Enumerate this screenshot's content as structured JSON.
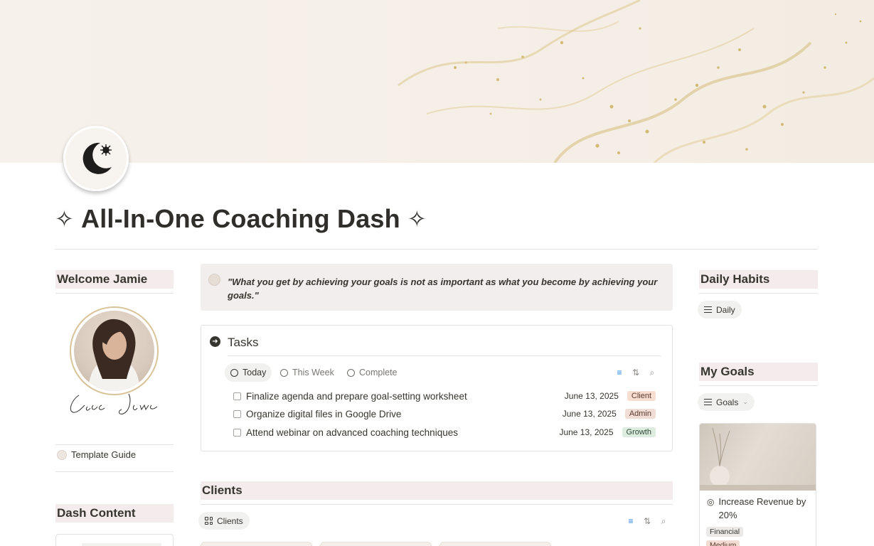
{
  "page": {
    "title": "All-In-One Coaching Dash",
    "title_decoration": "✧"
  },
  "left": {
    "welcome_heading": "Welcome Jamie",
    "template_guide_label": "Template Guide",
    "dash_content_heading": "Dash Content"
  },
  "quote": {
    "text": "\"What you get by achieving your goals is not as important as what you become by achieving your goals.\""
  },
  "tasks": {
    "heading": "Tasks",
    "tabs": [
      {
        "label": "Today",
        "active": true
      },
      {
        "label": "This Week",
        "active": false
      },
      {
        "label": "Complete",
        "active": false
      }
    ],
    "rows": [
      {
        "title": "Finalize agenda and prepare goal-setting worksheet",
        "date": "June 13, 2025",
        "tag": "Client"
      },
      {
        "title": "Organize digital files in Google Drive",
        "date": "June 13, 2025",
        "tag": "Admin"
      },
      {
        "title": "Attend webinar on advanced coaching techniques",
        "date": "June 13, 2025",
        "tag": "Growth"
      }
    ]
  },
  "clients": {
    "heading": "Clients",
    "view_label": "Clients"
  },
  "right": {
    "habits_heading": "Daily Habits",
    "habits_view_label": "Daily",
    "goals_heading": "My Goals",
    "goals_view_label": "Goals",
    "goal_card": {
      "title": "Increase Revenue by 20%",
      "tags": [
        "Financial",
        "Medium"
      ]
    }
  },
  "icons": {
    "page_icon": "crescent-moon-star-icon",
    "tasks_icon": "arrow-circle-icon",
    "filter": "filter-icon",
    "sort": "sort-icon",
    "search": "search-icon"
  },
  "colors": {
    "accent_blue": "#2383e2",
    "section_header_bg": "#f4ecec",
    "quote_bg": "#f3eeee",
    "client_tag": "#f6ddd0",
    "admin_tag": "#f1ddd5",
    "growth_tag": "#dcecdf"
  }
}
